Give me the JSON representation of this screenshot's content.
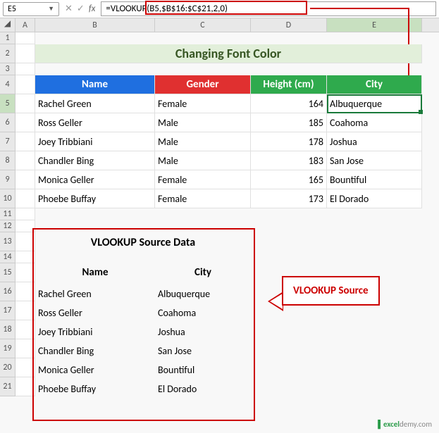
{
  "name_box": "E5",
  "formula": "=VLOOKUP(B5,$B$16:$C$21,2,0)",
  "columns": [
    "A",
    "B",
    "C",
    "D",
    "E"
  ],
  "rows": [
    "1",
    "2",
    "3",
    "4",
    "5",
    "6",
    "7",
    "8",
    "9",
    "10",
    "11",
    "12",
    "13",
    "14",
    "15",
    "16",
    "17",
    "18",
    "19",
    "20",
    "21"
  ],
  "title": "Changing Font Color",
  "headers": {
    "name": "Name",
    "gender": "Gender",
    "height": "Height (cm)",
    "city": "City"
  },
  "data": [
    {
      "name": "Rachel Green",
      "gender": "Female",
      "height": "164",
      "city": "Albuquerque"
    },
    {
      "name": "Ross Geller",
      "gender": "Male",
      "height": "185",
      "city": "Coahoma"
    },
    {
      "name": "Joey Tribbiani",
      "gender": "Male",
      "height": "178",
      "city": "Joshua"
    },
    {
      "name": "Chandler Bing",
      "gender": "Male",
      "height": "183",
      "city": "San Jose"
    },
    {
      "name": "Monica Geller",
      "gender": "Female",
      "height": "165",
      "city": "Bountiful"
    },
    {
      "name": "Phoebe Buffay",
      "gender": "Female",
      "height": "173",
      "city": "El Dorado"
    }
  ],
  "source_title": "VLOOKUP Source Data",
  "source_headers": {
    "name": "Name",
    "city": "City"
  },
  "source_data": [
    {
      "name": "Rachel Green",
      "city": "Albuquerque"
    },
    {
      "name": "Ross Geller",
      "city": "Coahoma"
    },
    {
      "name": "Joey Tribbiani",
      "city": "Joshua"
    },
    {
      "name": "Chandler Bing",
      "city": "San Jose"
    },
    {
      "name": "Monica Geller",
      "city": "Bountiful"
    },
    {
      "name": "Phoebe Buffay",
      "city": "El Dorado"
    }
  ],
  "callout": "VLOOKUP Source",
  "brand1": "excel",
  "brand2": "demy"
}
